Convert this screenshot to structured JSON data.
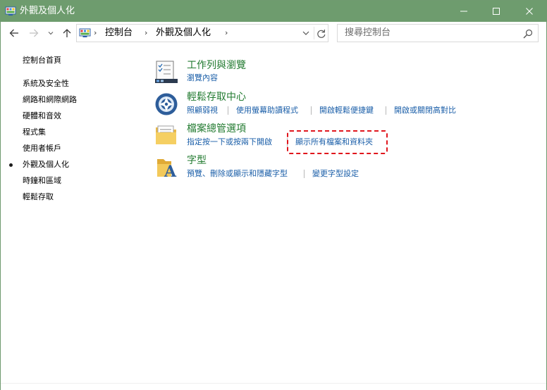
{
  "window": {
    "title": "外觀及個人化",
    "accent_color": "#6e9c6e"
  },
  "titlebar_buttons": {
    "minimize": "minimize-icon",
    "maximize": "maximize-icon",
    "close": "close-icon"
  },
  "navigation": {
    "back_icon": "arrow-left-icon",
    "forward_icon": "arrow-right-icon",
    "recent_icon": "chevron-down-icon",
    "up_icon": "arrow-up-icon"
  },
  "address": {
    "crumbs": [
      "控制台",
      "外觀及個人化"
    ],
    "separator": "›"
  },
  "search": {
    "placeholder": "搜尋控制台"
  },
  "sidebar": {
    "items": [
      {
        "label": "控制台首頁",
        "active": false
      },
      {
        "label": "系統及安全性",
        "active": false
      },
      {
        "label": "網路和網際網路",
        "active": false
      },
      {
        "label": "硬體和音效",
        "active": false
      },
      {
        "label": "程式集",
        "active": false
      },
      {
        "label": "使用者帳戶",
        "active": false
      },
      {
        "label": "外觀及個人化",
        "active": true
      },
      {
        "label": "時鐘和區域",
        "active": false
      },
      {
        "label": "輕鬆存取",
        "active": false
      }
    ]
  },
  "categories": [
    {
      "title": "工作列與瀏覽",
      "icon": "taskbar-navigation-icon",
      "links": [
        "瀏覽內容"
      ]
    },
    {
      "title": "輕鬆存取中心",
      "icon": "ease-of-access-icon",
      "links": [
        "照顧弱視",
        "使用螢幕助讀程式",
        "開啟輕鬆便捷鍵",
        "開啟或關閉高對比"
      ]
    },
    {
      "title": "檔案總管選項",
      "icon": "folder-options-icon",
      "links": [
        "指定按一下或按兩下開啟",
        "顯示所有檔案和資料夾"
      ]
    },
    {
      "title": "字型",
      "icon": "fonts-folder-icon",
      "links": [
        "預覽、刪除或顯示和隱藏字型",
        "變更字型設定"
      ]
    }
  ],
  "colors": {
    "category_title": "#217a2f",
    "link": "#1a5ea8",
    "highlight": "#e0161d"
  }
}
